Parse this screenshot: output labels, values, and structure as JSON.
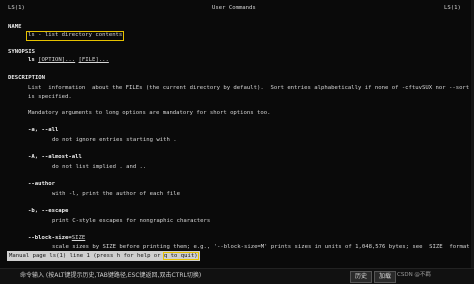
{
  "header": {
    "left": "LS(1)",
    "center": "User Commands",
    "right": "LS(1)"
  },
  "name_section": {
    "heading": "NAME",
    "line": "ls - list directory contents"
  },
  "synopsis": {
    "heading": "SYNOPSIS",
    "cmd": "ls",
    "option": "[OPTION]...",
    "file": "[FILE]..."
  },
  "description": {
    "heading": "DESCRIPTION",
    "para1": "List  information  about the FILEs (the current directory by default).  Sort entries alphabetically if none of -cftuvSUX nor --sort",
    "para1b": "is specified.",
    "para2": "Mandatory arguments to long options are mandatory for short options too.",
    "options": [
      {
        "flag": "-a, --all",
        "desc": "do not ignore entries starting with ."
      },
      {
        "flag": "-A, --almost-all",
        "desc": "do not list implied . and .."
      },
      {
        "flag": "--author",
        "desc": "with -l, print the author of each file"
      },
      {
        "flag": "-b, --escape",
        "desc": "print C-style escapes for nongraphic characters"
      }
    ],
    "block_size_flag": "--block-size=",
    "block_size_arg": "SIZE",
    "block_size_desc": "scale sizes by SIZE before printing them; e.g., '--block-size=M' prints sizes in units of 1,048,576 bytes; see  SIZE  format"
  },
  "status_bar": {
    "text": "Manual page ls(1) line 1 (press h for help or ",
    "quit": "q to quit)"
  },
  "bottom_bar": {
    "command_prompt": "命令输入 (按ALT键提示历史,TAB键路径,ESC键返回,双击CTRL切换)",
    "history_button": "历史",
    "load_button": "加载",
    "watermark": "CSDN @不羁"
  }
}
